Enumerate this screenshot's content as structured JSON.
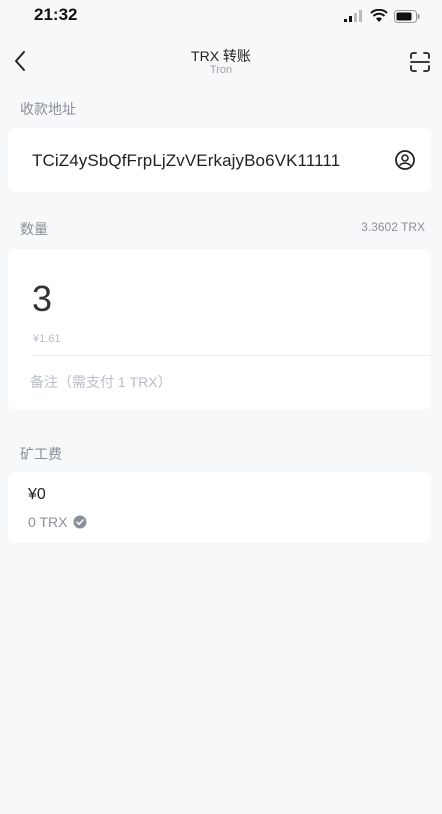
{
  "status_bar": {
    "time": "21:32"
  },
  "header": {
    "title": "TRX 转账",
    "subtitle": "Tron"
  },
  "recipient": {
    "label": "收款地址",
    "address": "TCiZ4ySbQfFrpLjZvVErkajyBo6VK11111"
  },
  "amount": {
    "label": "数量",
    "balance": "3.3602 TRX",
    "value": "3",
    "fiat": "¥1.61",
    "memo_placeholder": "备注（需支付 1 TRX）"
  },
  "fee": {
    "label": "矿工费",
    "fiat": "¥0",
    "trx": "0 TRX"
  },
  "icons": {
    "back": "chevron-left-icon",
    "scan": "scan-icon",
    "contact": "contact-icon",
    "check": "check-circle-icon"
  },
  "colors": {
    "background": "#f7f8fa",
    "card": "#ffffff",
    "label": "#8a8f99",
    "placeholder": "#b9bdc4",
    "text": "#222222"
  }
}
